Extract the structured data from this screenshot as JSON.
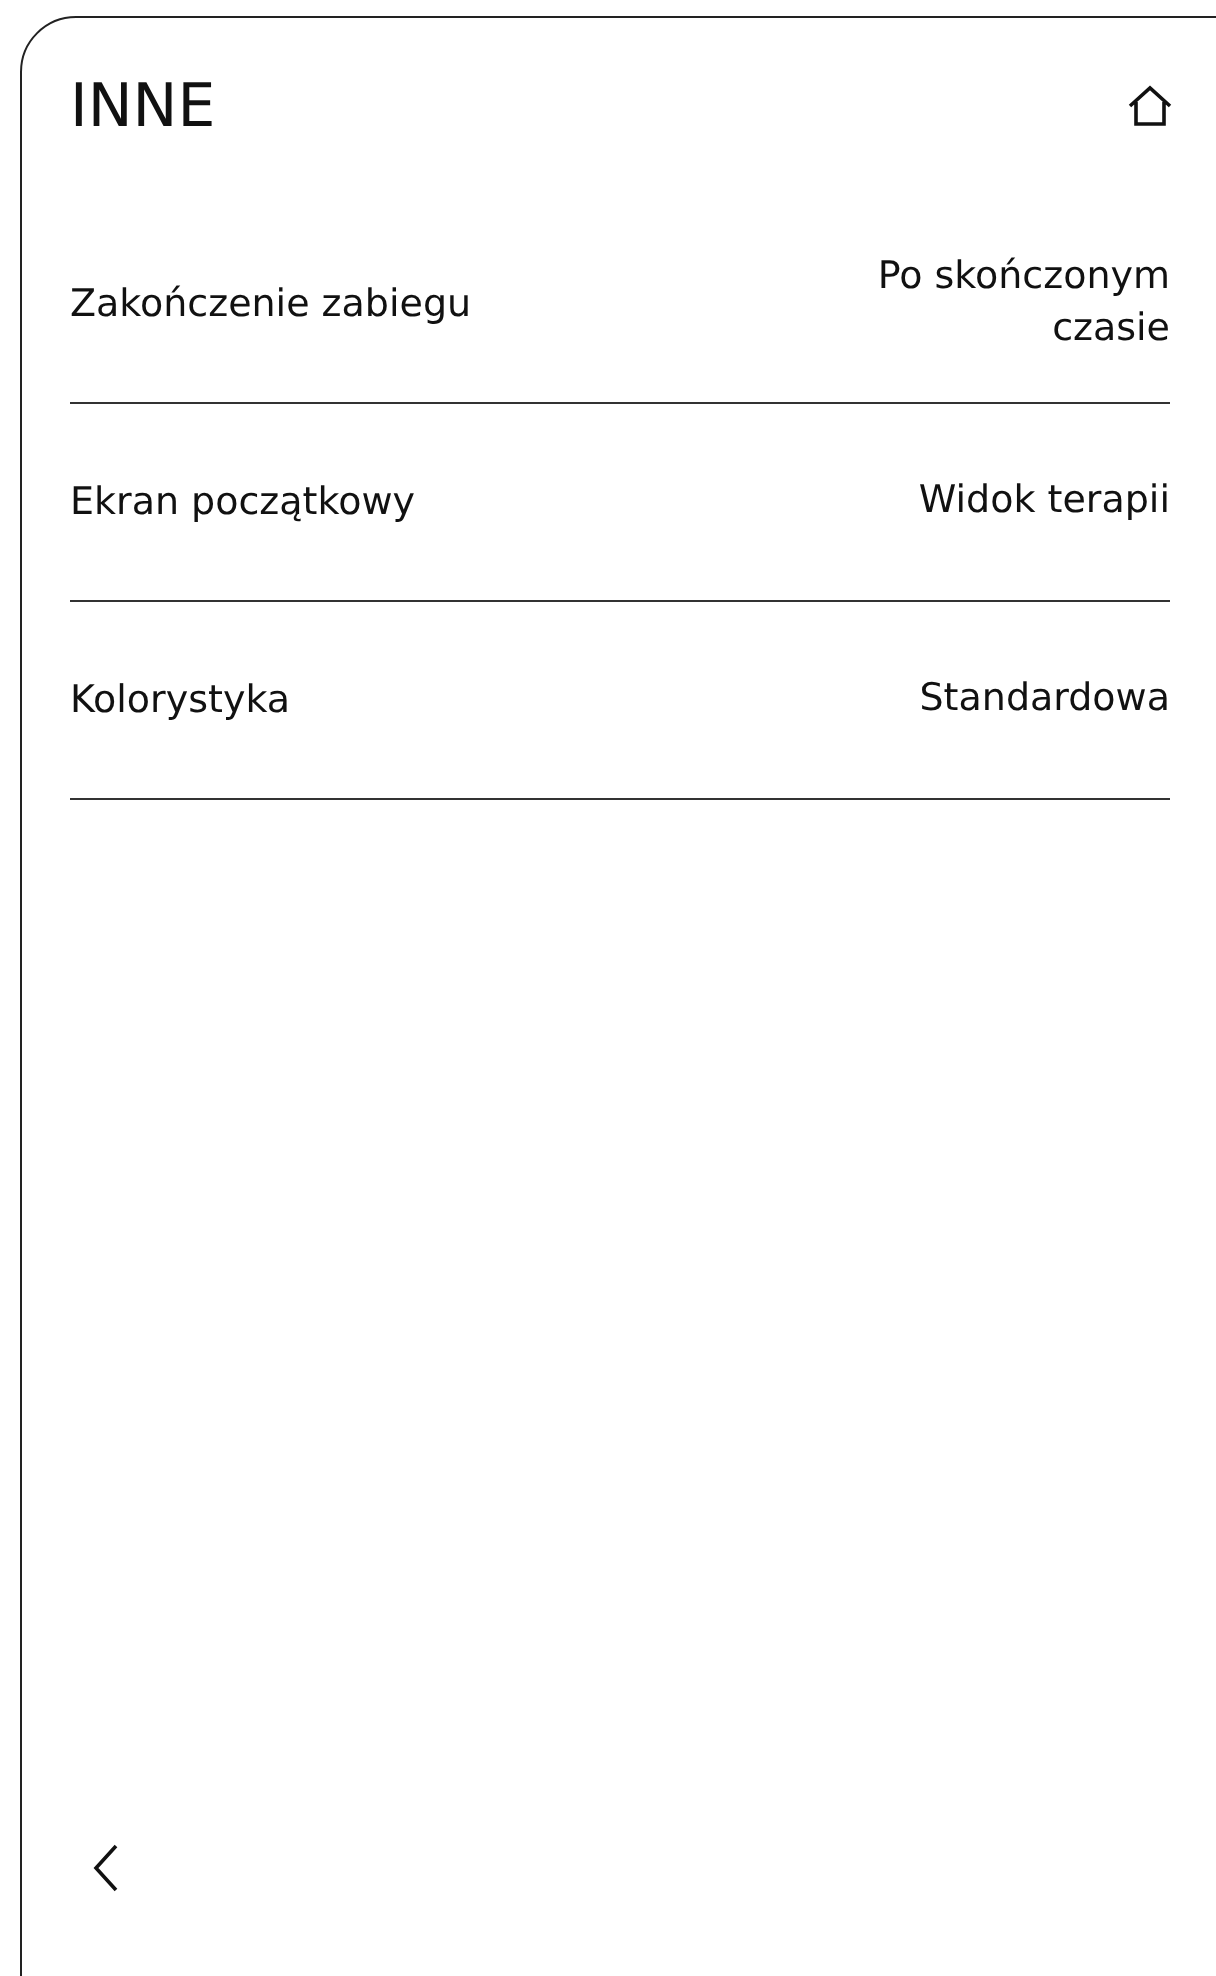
{
  "header": {
    "title": "INNE"
  },
  "settings": [
    {
      "label": "Zakończenie zabiegu",
      "value": "Po skończonym czasie"
    },
    {
      "label": "Ekran początkowy",
      "value": "Widok terapii"
    },
    {
      "label": "Kolorystyka",
      "value": "Standardowa"
    }
  ]
}
